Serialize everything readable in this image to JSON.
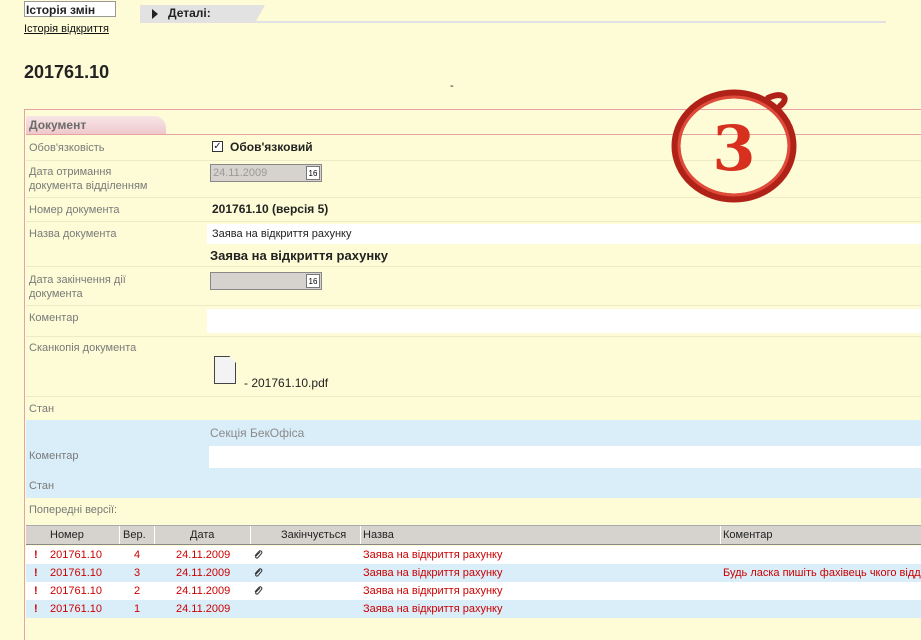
{
  "nav": {
    "history_tab": "Історія змін",
    "open_history_link": "Історія відкриття"
  },
  "details": {
    "label": "Деталі:"
  },
  "page": {
    "title": "201761.10",
    "dash": "-"
  },
  "section": {
    "title": "Документ"
  },
  "form": {
    "mandatory_label": "Обов'язковість",
    "mandatory_checkbox_label": "Обов'язковий",
    "receipt_date_label_1": "Дата отримання",
    "receipt_date_label_2": "документа відділенням",
    "receipt_date_value": "24.11.2009",
    "calendar_icon_text": "16",
    "doc_number_label": "Номер документа",
    "doc_number_value": "201761.10 (версія 5)",
    "doc_name_label": "Назва документа",
    "doc_name_value": "Заява на відкриття рахунку",
    "doc_name_title": "Заява на відкриття рахунку",
    "end_date_label_1": "Дата закінчення дії",
    "end_date_label_2": "документа",
    "end_date_value": "",
    "comment_label": "Коментар",
    "scan_label": "Сканкопія документа",
    "scan_file": "- 201761.10.pdf",
    "status_label": "Стан",
    "backoffice_section": "Секція БекОфіса",
    "bo_comment_label": "Коментар",
    "bo_status_label": "Стан",
    "prev_versions_label": "Попередні версії:"
  },
  "stamp": {
    "text": "3",
    "color": "#cc2a1f"
  },
  "grid": {
    "headers": [
      "Номер",
      "Вер.",
      "Дата",
      "Закінчується",
      "Назва",
      "Коментар"
    ],
    "rows": [
      {
        "flag": "!",
        "number": "201761.10",
        "version": "4",
        "date": "24.11.2009",
        "attachment": true,
        "name": "Заява на відкриття рахунку",
        "comment": ""
      },
      {
        "flag": "!",
        "number": "201761.10",
        "version": "3",
        "date": "24.11.2009",
        "attachment": true,
        "name": "Заява на відкриття рахунку",
        "comment": "Будь ласка пишіть фахівець чкого відд"
      },
      {
        "flag": "!",
        "number": "201761.10",
        "version": "2",
        "date": "24.11.2009",
        "attachment": true,
        "name": "Заява на відкриття рахунку",
        "comment": ""
      },
      {
        "flag": "!",
        "number": "201761.10",
        "version": "1",
        "date": "24.11.2009",
        "attachment": false,
        "name": "Заява на відкриття рахунку",
        "comment": ""
      }
    ]
  },
  "colors": {
    "accent_red": "#cc0000",
    "row_highlight": "#daeefa",
    "background": "#fdfcd6"
  }
}
